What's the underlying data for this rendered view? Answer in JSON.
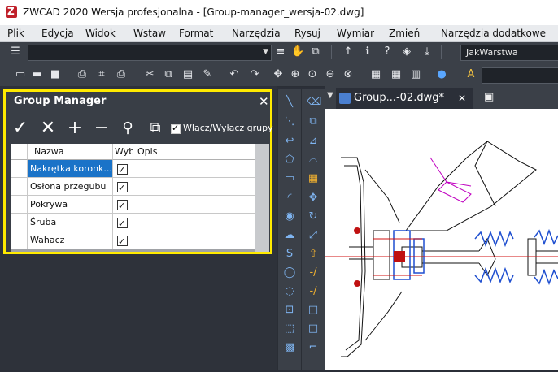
{
  "window": {
    "title": "ZWCAD 2020 Wersja profesjonalna - [Group-manager_wersja-02.dwg]"
  },
  "menu": [
    "Plik",
    "Edycja",
    "Widok",
    "Wstaw",
    "Format",
    "Narzędzia",
    "Rysuj",
    "Wymiar",
    "Zmień",
    "Narzędzia dodatkowe"
  ],
  "toolbar": {
    "layer_combo_value": "",
    "layer_style_value": "JakWarstwa"
  },
  "group_manager": {
    "title": "Group Manager",
    "toggle_label": "Włącz/Wyłącz grupy",
    "toggle_checked": true,
    "columns": [
      "Nazwa",
      "Wyb",
      "Opis"
    ],
    "rows": [
      {
        "name": "Nakrętka koronk...",
        "selected": true,
        "desc": ""
      },
      {
        "name": "Osłona przegubu",
        "selected": true,
        "desc": ""
      },
      {
        "name": "Pokrywa",
        "selected": true,
        "desc": ""
      },
      {
        "name": "Śruba",
        "selected": true,
        "desc": ""
      },
      {
        "name": "Wahacz",
        "selected": true,
        "desc": ""
      }
    ],
    "highlight_color": "#ffea00"
  },
  "document_tab": {
    "label": "Group...-02.dwg*"
  },
  "colors": {
    "accent": "#1a73c8",
    "ui_dark": "#3b4048"
  }
}
